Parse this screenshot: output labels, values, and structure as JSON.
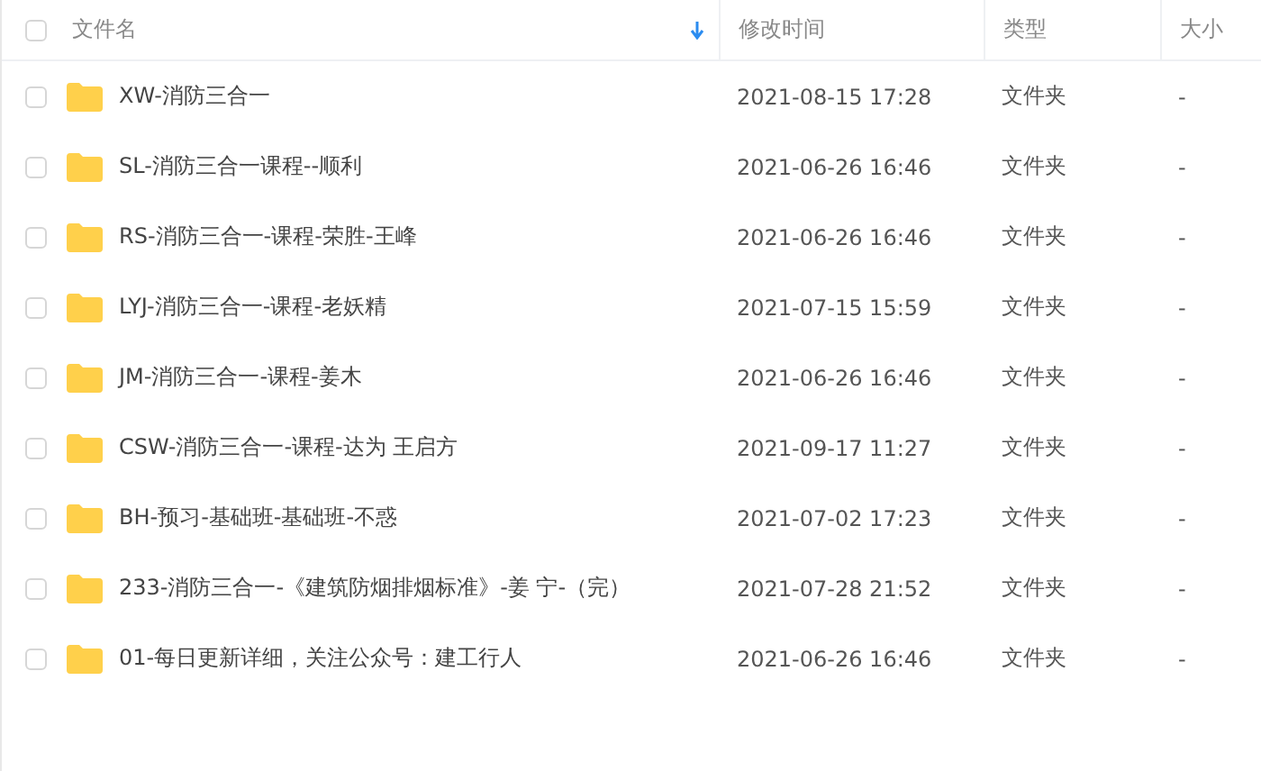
{
  "header": {
    "select_all": {
      "checked": false
    },
    "columns": [
      {
        "label": "文件名",
        "sorted": true
      },
      {
        "label": "修改时间",
        "sorted": false
      },
      {
        "label": "类型",
        "sorted": false
      },
      {
        "label": "大小",
        "sorted": false
      }
    ]
  },
  "rows": [
    {
      "name": "XW-消防三合一",
      "modified": "2021-08-15 17:28",
      "type": "文件夹",
      "size": "-",
      "checked": false
    },
    {
      "name": "SL-消防三合一课程--顺利",
      "modified": "2021-06-26 16:46",
      "type": "文件夹",
      "size": "-",
      "checked": false
    },
    {
      "name": "RS-消防三合一-课程-荣胜-王峰",
      "modified": "2021-06-26 16:46",
      "type": "文件夹",
      "size": "-",
      "checked": false
    },
    {
      "name": "LYJ-消防三合一-课程-老妖精",
      "modified": "2021-07-15 15:59",
      "type": "文件夹",
      "size": "-",
      "checked": false
    },
    {
      "name": "JM-消防三合一-课程-姜木",
      "modified": "2021-06-26 16:46",
      "type": "文件夹",
      "size": "-",
      "checked": false
    },
    {
      "name": "CSW-消防三合一-课程-达为 王启方",
      "modified": "2021-09-17 11:27",
      "type": "文件夹",
      "size": "-",
      "checked": false
    },
    {
      "name": "BH-预习-基础班-基础班-不惑",
      "modified": "2021-07-02 17:23",
      "type": "文件夹",
      "size": "-",
      "checked": false
    },
    {
      "name": "233-消防三合一-《建筑防烟排烟标准》-姜 宁-（完）",
      "modified": "2021-07-28 21:52",
      "type": "文件夹",
      "size": "-",
      "checked": false
    },
    {
      "name": "01-每日更新详细，关注公众号：建工行人",
      "modified": "2021-06-26 16:46",
      "type": "文件夹",
      "size": "-",
      "checked": false
    }
  ]
}
